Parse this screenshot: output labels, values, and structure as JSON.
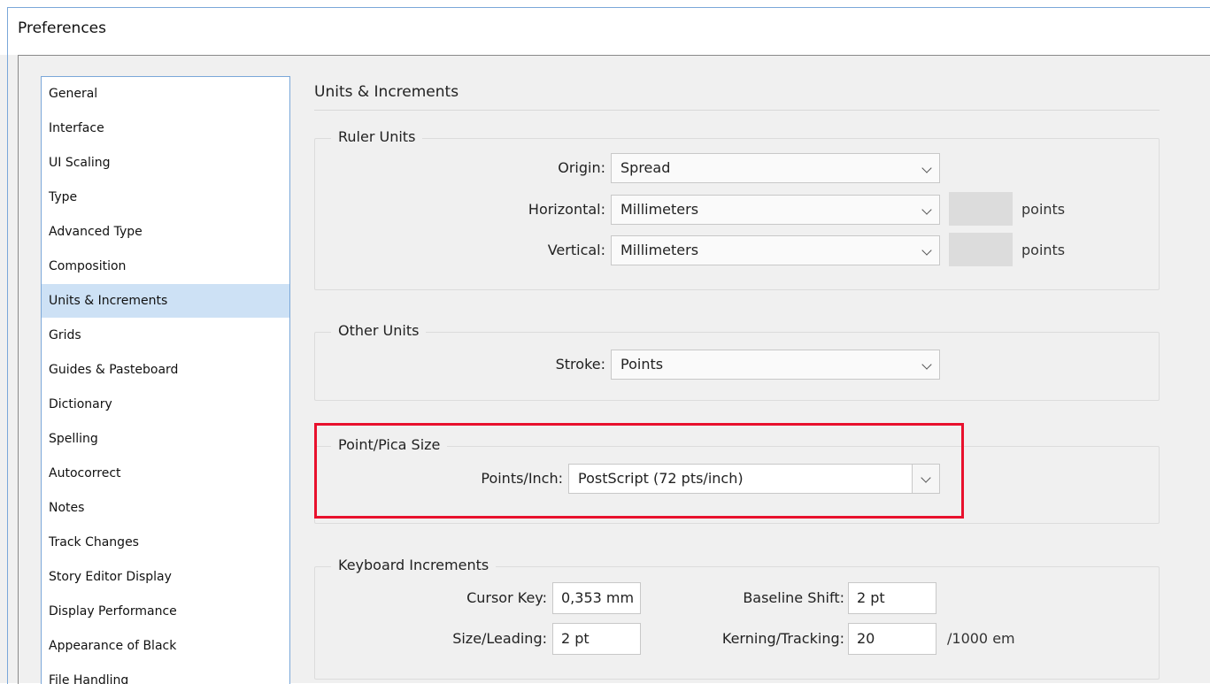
{
  "window": {
    "title": "Preferences"
  },
  "sidebar": {
    "items": [
      {
        "label": "General"
      },
      {
        "label": "Interface"
      },
      {
        "label": "UI Scaling"
      },
      {
        "label": "Type"
      },
      {
        "label": "Advanced Type"
      },
      {
        "label": "Composition"
      },
      {
        "label": "Units & Increments",
        "selected": true
      },
      {
        "label": "Grids"
      },
      {
        "label": "Guides & Pasteboard"
      },
      {
        "label": "Dictionary"
      },
      {
        "label": "Spelling"
      },
      {
        "label": "Autocorrect"
      },
      {
        "label": "Notes"
      },
      {
        "label": "Track Changes"
      },
      {
        "label": "Story Editor Display"
      },
      {
        "label": "Display Performance"
      },
      {
        "label": "Appearance of Black"
      },
      {
        "label": "File Handling"
      }
    ]
  },
  "main": {
    "title": "Units & Increments",
    "ruler_units": {
      "label": "Ruler Units",
      "origin_label": "Origin:",
      "origin_value": "Spread",
      "horizontal_label": "Horizontal:",
      "horizontal_value": "Millimeters",
      "horizontal_unit": "points",
      "vertical_label": "Vertical:",
      "vertical_value": "Millimeters",
      "vertical_unit": "points"
    },
    "other_units": {
      "label": "Other Units",
      "stroke_label": "Stroke:",
      "stroke_value": "Points"
    },
    "point_pica": {
      "label": "Point/Pica Size",
      "points_inch_label": "Points/Inch:",
      "points_inch_value": "PostScript (72 pts/inch)"
    },
    "keyboard": {
      "label": "Keyboard Increments",
      "cursor_key_label": "Cursor Key:",
      "cursor_key_value": "0,353 mm",
      "baseline_shift_label": "Baseline Shift:",
      "baseline_shift_value": "2 pt",
      "size_leading_label": "Size/Leading:",
      "size_leading_value": "2 pt",
      "kerning_label": "Kerning/Tracking:",
      "kerning_value": "20",
      "kerning_unit": "/1000 em"
    }
  },
  "colors": {
    "highlight": "#e8112d",
    "selection": "#cde1f5",
    "window_border": "#7aa7d9"
  }
}
